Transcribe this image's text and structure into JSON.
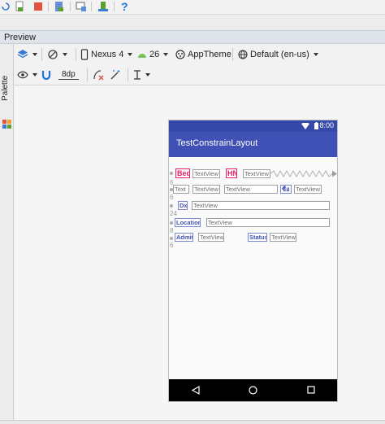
{
  "top_toolbar": {
    "icons": [
      "reload-icon",
      "device-file-icon",
      "stop-icon",
      "sdk-manager-icon",
      "device-monitor-icon",
      "avd-icon",
      "help-icon"
    ],
    "help_glyph": "?"
  },
  "preview": {
    "title": "Preview"
  },
  "palette": {
    "label": "Palette"
  },
  "design_toolbar": {
    "device": "Nexus 4",
    "api": "26",
    "theme": "AppTheme",
    "locale": "Default (en-us)",
    "margin": "8dp"
  },
  "phone": {
    "status_time": "8:00",
    "app_title": "TestConstrainLayout",
    "row1": {
      "label": "Bed",
      "value1": "TextView",
      "label2": "HN",
      "value2": "TextView"
    },
    "row2": {
      "label": "Text",
      "value1": "TextView",
      "value2": "TextView",
      "label2": "ชื่อ",
      "value3": "TextView"
    },
    "row3": {
      "label": "Dx",
      "value": "TextView"
    },
    "row4": {
      "label": "Location",
      "value": "TextView"
    },
    "row5": {
      "label": "Admit",
      "value1": "TextView",
      "label2": "Status",
      "value2": "TextView"
    },
    "margins": [
      "6",
      "6",
      "24",
      "8",
      "6"
    ]
  },
  "colors": {
    "primary": "#3f51b5",
    "primary_dark": "#3648a8",
    "accent_pink": "#e91e63",
    "help_blue": "#1e73d6"
  }
}
